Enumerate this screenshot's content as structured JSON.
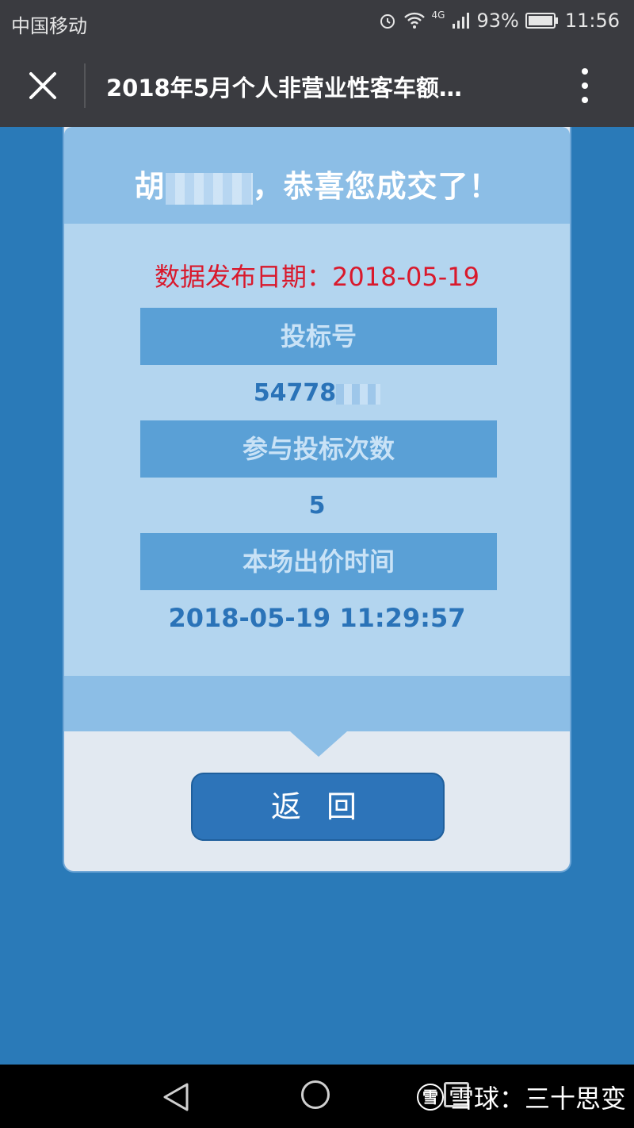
{
  "status_bar": {
    "carrier": "中国移动",
    "network": "4G",
    "battery": "93%",
    "time": "11:56"
  },
  "title_bar": {
    "title": "2018年5月个人非营业性客车额…"
  },
  "card": {
    "congrats_prefix": "胡",
    "congrats_suffix": "，恭喜您成交了！",
    "date_label": "数据发布日期：",
    "date_value": "2018-05-19",
    "bid_number_label": "投标号",
    "bid_number_value": "54778",
    "bid_count_label": "参与投标次数",
    "bid_count_value": "5",
    "bid_time_label": "本场出价时间",
    "bid_time_value": "2018-05-19 11:29:57",
    "back_button": "返 回"
  },
  "watermark": {
    "logo": "雪",
    "text": "雪球：三十思变"
  },
  "colors": {
    "background": "#2a7ab8",
    "header_band": "#8cbee6",
    "body": "#b3d5ef",
    "label_box": "#5aa0d6",
    "date_red": "#d9192c",
    "value_blue": "#2a73b8",
    "button": "#2d74b9"
  }
}
